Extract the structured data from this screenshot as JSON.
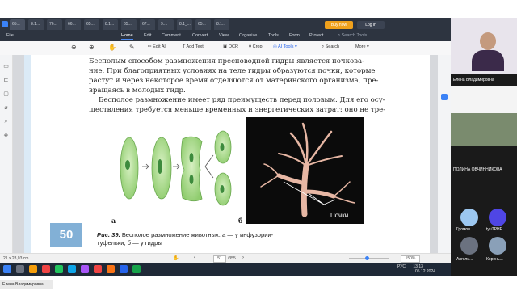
{
  "tabs": [
    "65...",
    "8.1...",
    "76...",
    "66...",
    "65...",
    "8.1...",
    "65...",
    "67...",
    "9....",
    "8.1_...",
    "65...",
    "8.1..."
  ],
  "window": {
    "buy_now": "Buy now",
    "login": "Log in"
  },
  "menu": {
    "file": "File",
    "items": [
      "Home",
      "Edit",
      "Comment",
      "Convert",
      "View",
      "Organize",
      "Tools",
      "Form",
      "Protect"
    ],
    "search_tools": "Search Tools"
  },
  "toolbar": {
    "edit_all": "Edit All",
    "add_text": "Add Text",
    "ocr": "OCR",
    "crop": "Crop",
    "ai_tools": "AI Tools",
    "search": "Search",
    "more": "More"
  },
  "document": {
    "page_number": "50",
    "lines": [
      "Бесполым способом размножения пресноводной гидры является почкова-",
      "ние. При благоприятных условиях на теле гидры образуются почки, которые",
      "растут и через некоторое время отделяются от материнского организма, пре-",
      "вращаясь в молодых гидр.",
      "Бесполое размножение имеет ряд преимуществ перед половым. Для его осу-",
      "ществления требуется меньше временных и энергетических затрат: оно не тре-"
    ],
    "label_a": "а",
    "label_b": "б",
    "photo_label": "Почки",
    "caption_bold": "Рис. 39.",
    "caption_line1": "Бесполое размножение животных: а — у инфузории-",
    "caption_line2": "туфельки; б — у гидры"
  },
  "status": {
    "dimensions": "21 x 28,03 cm",
    "page_current": "51",
    "page_total": "/355",
    "zoom": "150%"
  },
  "taskbar": {
    "lang": "РУС",
    "time": "13:13",
    "date": "05.12.2024"
  },
  "participants": {
    "host_name": "Елена Владимировна",
    "name2": "ПОЛИНА ОВЧИННИКОВА",
    "tile_a": "Громов...",
    "tile_b": "tyuTPHE...",
    "tile_c": "Ангели...",
    "tile_d": "Корень..."
  },
  "bottom": {
    "speaker": "Елена Владимировна"
  }
}
